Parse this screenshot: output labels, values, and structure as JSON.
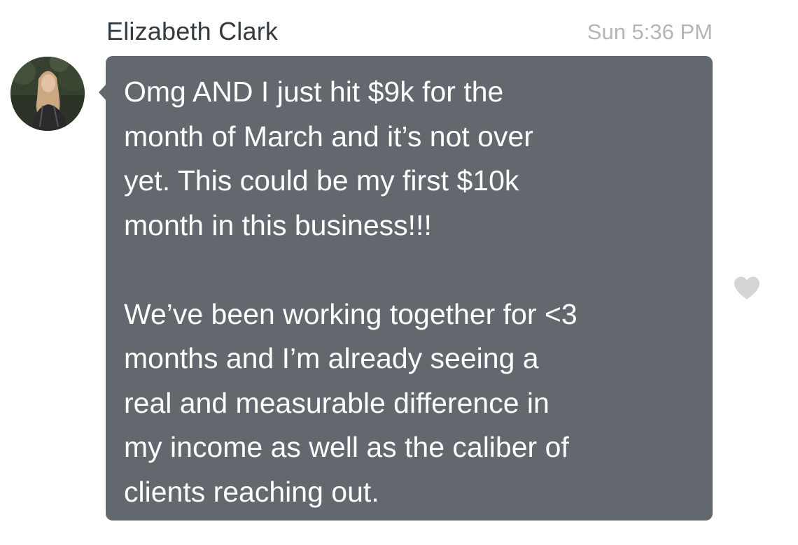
{
  "message": {
    "sender_name": "Elizabeth Clark",
    "timestamp": "Sun 5:36 PM",
    "text": "Omg AND I just hit $9k for the\nmonth of March and it’s not over\nyet. This could be my first $10k\nmonth in this business!!!\n\nWe’ve been working together for <3\nmonths and I’m already seeing a\nreal and measurable difference in\nmy income as well as the caliber of\nclients reaching out.",
    "liked": false
  },
  "icons": {
    "avatar": "profile-photo-avatar",
    "reaction": "heart-icon"
  },
  "colors": {
    "bubble": "#62686d",
    "bubble_text": "#ffffff",
    "sender_name": "#333a40",
    "timestamp": "#b3b6b9",
    "heart": "#d3d5d7"
  }
}
